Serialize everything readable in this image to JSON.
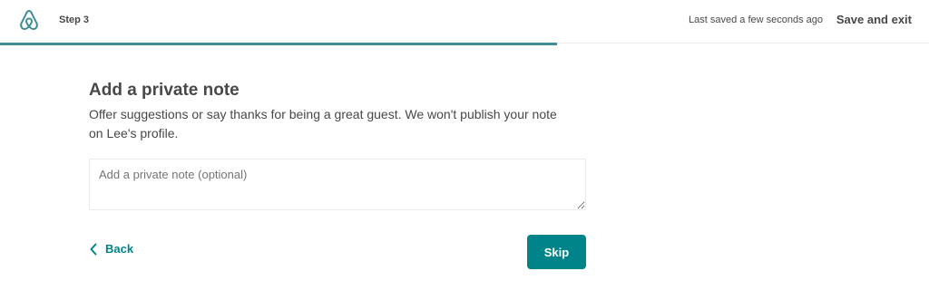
{
  "header": {
    "logo_icon": "airbnb-belo-icon",
    "step_label": "Step 3",
    "saved_status": "Last saved a few seconds ago",
    "save_exit_label": "Save and exit"
  },
  "progress": {
    "fraction": 0.6,
    "color": "#408d95"
  },
  "main": {
    "title": "Add a private note",
    "description": "Offer suggestions or say thanks for being a great guest. We won't publish your note on Lee's profile.",
    "note_input": {
      "value": "",
      "placeholder": "Add a private note (optional)"
    }
  },
  "footer": {
    "back_label": "Back",
    "back_icon": "chevron-left-icon",
    "skip_label": "Skip"
  },
  "colors": {
    "accent": "#008489",
    "text": "#484848",
    "border": "#ebebeb"
  }
}
